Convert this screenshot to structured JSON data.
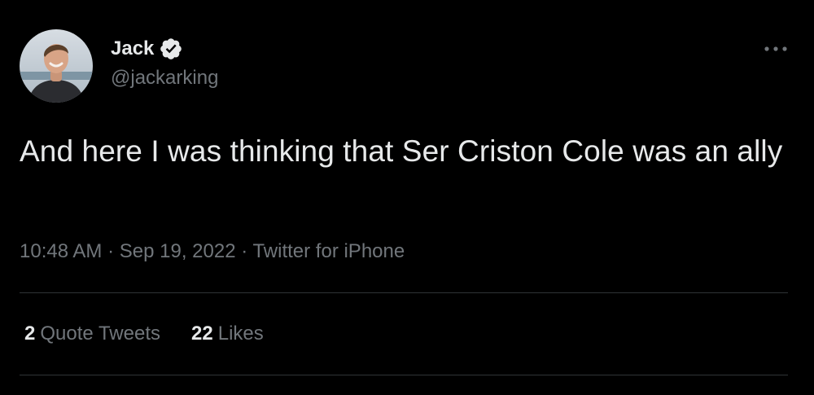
{
  "colors": {
    "background": "#000000",
    "primary_text": "#e7e9ea",
    "secondary_text": "#71767b",
    "divider": "#2f3336",
    "verified_badge": "#e7e9ea"
  },
  "author": {
    "display_name": "Jack",
    "handle": "@jackarking",
    "verified_icon": "verified-check-icon",
    "avatar_icon": "profile-photo"
  },
  "menu": {
    "icon": "more-horizontal-icon"
  },
  "tweet": {
    "text": "And here I was thinking that Ser Criston Cole was an ally"
  },
  "meta": {
    "time": "10:48 AM",
    "date": "Sep 19, 2022",
    "source": "Twitter for iPhone",
    "separator": "·"
  },
  "stats": {
    "quote_tweets": {
      "count": "2",
      "label": "Quote Tweets"
    },
    "likes": {
      "count": "22",
      "label": "Likes"
    }
  }
}
